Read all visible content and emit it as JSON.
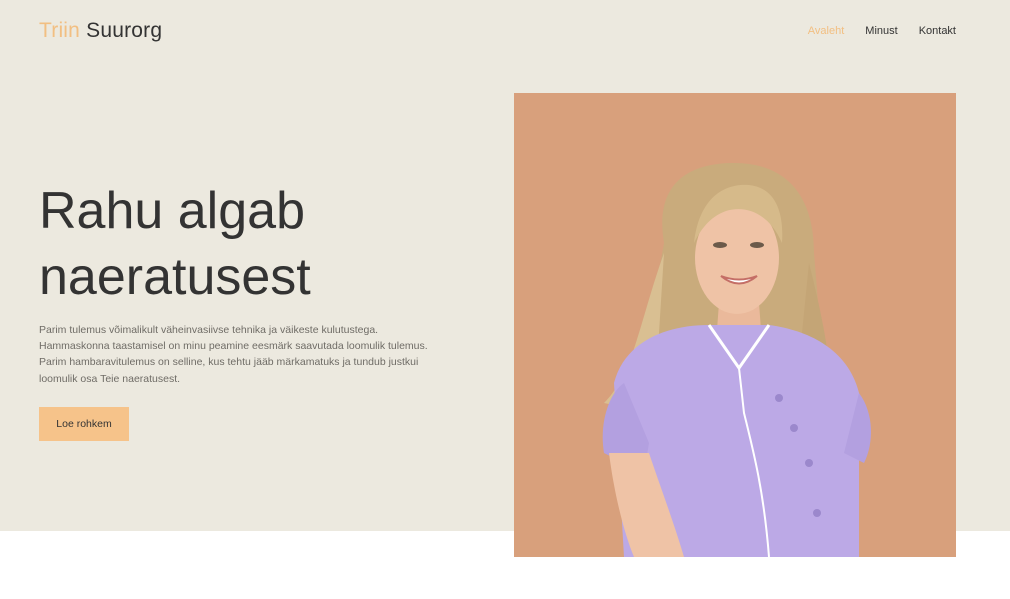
{
  "brand": {
    "first": "Triin",
    "last": "Suurorg",
    "accent": "#f2bf82"
  },
  "nav": {
    "items": [
      {
        "label": "Avaleht",
        "active": true
      },
      {
        "label": "Minust",
        "active": false
      },
      {
        "label": "Kontakt",
        "active": false
      }
    ]
  },
  "hero": {
    "headline": [
      "Rahu algab",
      "naeratusest"
    ],
    "lead": [
      "Parim tulemus võimalikult väheinvasiivse tehnika ja väikeste kulutustega.",
      "Hammaskonna taastamisel on minu peamine eesmärk saavutada loomulik tulemus.",
      "Parim hambaravitulemus on selline, kus tehtu jääb märkamatuks ja tundub justkui",
      "loomulik osa Teie naeratusest."
    ],
    "cta_label": "Loe rohkem"
  },
  "colors": {
    "hero_background": "#ece9df",
    "photo_background": "#d8a07c",
    "button": "#f6c38a",
    "text": "#333333"
  }
}
